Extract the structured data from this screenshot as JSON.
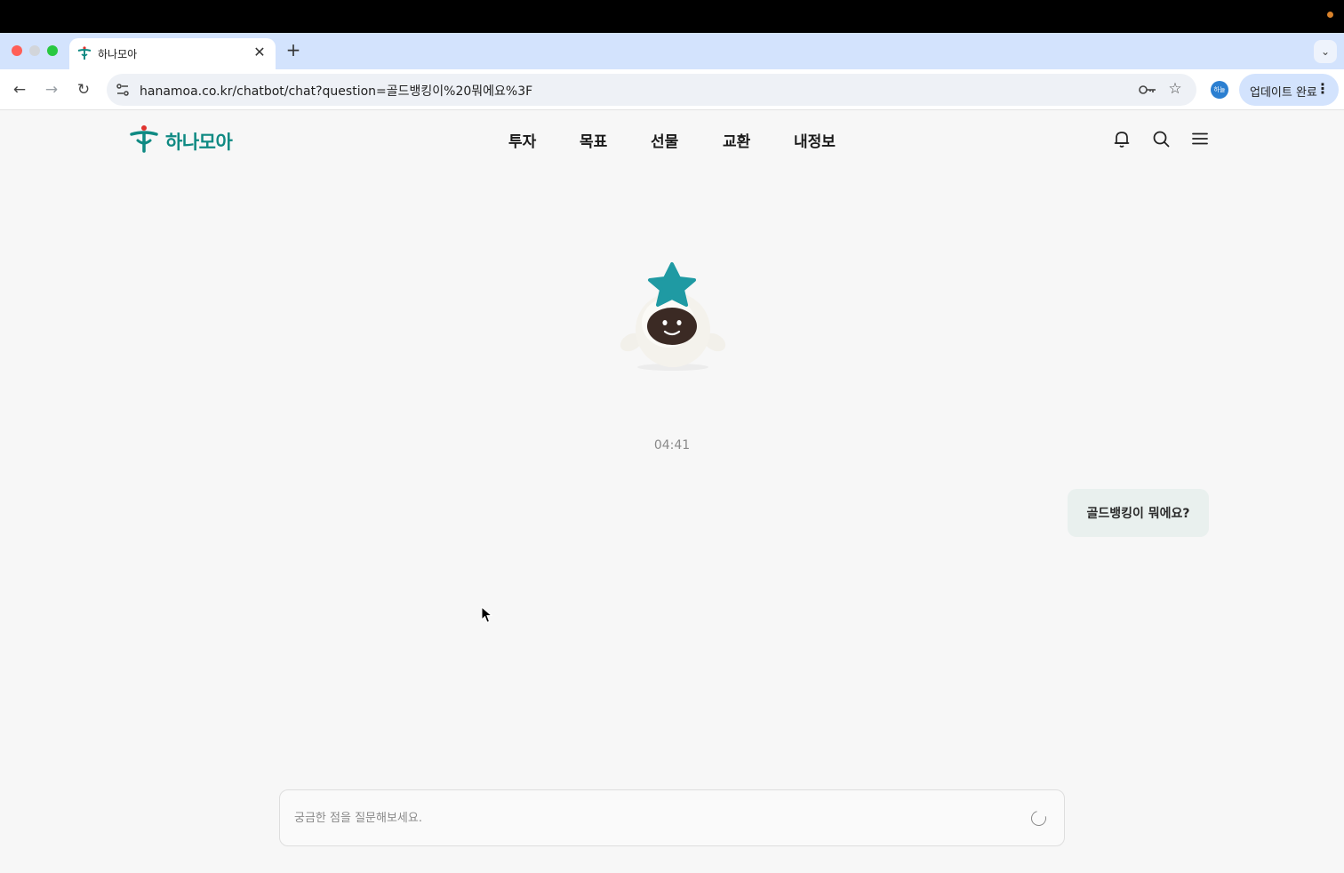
{
  "browser": {
    "tab_title": "하나모아",
    "url": "hanamoa.co.kr/chatbot/chat?question=골드뱅킹이%20뭐에요%3F",
    "profile_initials": "하늘",
    "update_button_label": "업데이트 완료"
  },
  "header": {
    "logo_text": "하나모아",
    "nav": [
      {
        "label": "투자"
      },
      {
        "label": "목표"
      },
      {
        "label": "선물"
      },
      {
        "label": "교환"
      },
      {
        "label": "내정보"
      }
    ],
    "icons": [
      "bell-icon",
      "search-icon",
      "menu-icon"
    ]
  },
  "chat": {
    "timestamp": "04:41",
    "messages": [
      {
        "sender": "user",
        "text": "골드뱅킹이 뭐에요?"
      }
    ],
    "input_placeholder": "궁금한 점을 질문해보세요.",
    "loading": true
  },
  "colors": {
    "brand": "#0f8a83",
    "user_bubble": "#e9f0ee",
    "page_bg": "#f7f7f7"
  }
}
